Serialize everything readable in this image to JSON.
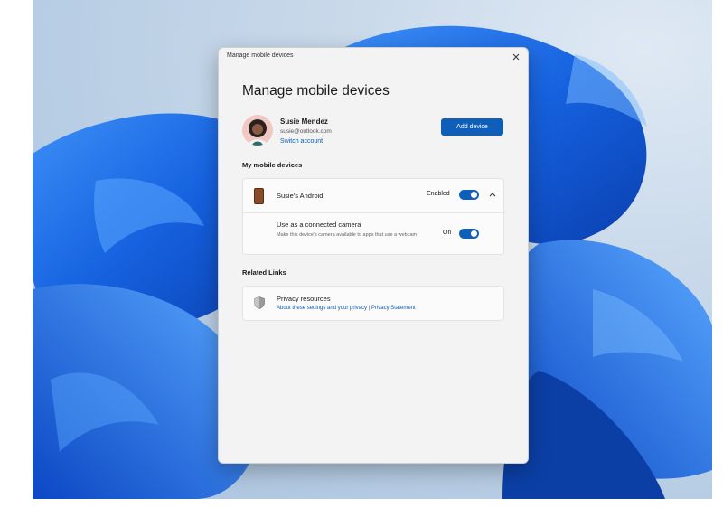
{
  "window": {
    "title": "Manage mobile devices",
    "heading": "Manage mobile devices"
  },
  "account": {
    "name": "Susie Mendez",
    "email": "susie@outlook.com",
    "switch_label": "Switch account",
    "add_device_label": "Add device"
  },
  "devices": {
    "section_label": "My mobile devices",
    "items": [
      {
        "name": "Susie's Android",
        "status_label": "Enabled",
        "enabled": true,
        "expanded": true,
        "settings": [
          {
            "title": "Use as a connected camera",
            "description": "Make this device's camera available to apps that use a webcam",
            "state_label": "On",
            "on": true
          }
        ]
      }
    ]
  },
  "related": {
    "section_label": "Related Links",
    "items": [
      {
        "title": "Privacy resources",
        "link1": "About these settings and your privacy",
        "separator": "|",
        "link2": "Privacy Statement"
      }
    ]
  },
  "colors": {
    "accent": "#0f5fb8",
    "link": "#0b5cad",
    "window_bg": "#f3f3f3"
  },
  "icons": {
    "close": "close-icon",
    "phone": "phone-icon",
    "chevron": "chevron-up-icon",
    "shield": "shield-icon"
  }
}
